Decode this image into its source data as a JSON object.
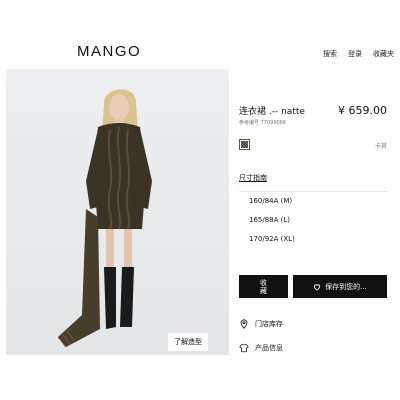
{
  "header": {
    "logo": "MANGO",
    "nav": {
      "search": "搜索",
      "login": "登录",
      "favorites": "收藏夹"
    }
  },
  "hero": {
    "model_tag": "了解造型"
  },
  "product": {
    "name": "连衣裙 .-- natte",
    "reference": "参考编号 77099066",
    "price": "¥ 659.00",
    "color_name": "卡其",
    "size_guide": "尺寸指南",
    "sizes": [
      "160/84A (M)",
      "165/88A (L)",
      "170/92A (XL)"
    ],
    "collect_button": {
      "line1": "收",
      "line2": "藏"
    },
    "save_button": "保存到您的...",
    "store_stock": "门店库存",
    "product_info": "产品信息"
  },
  "colors": {
    "background": "#ffffff",
    "photo_bg": "#e6e8ea",
    "button_bg": "#111111",
    "garment": "#3b3424"
  }
}
